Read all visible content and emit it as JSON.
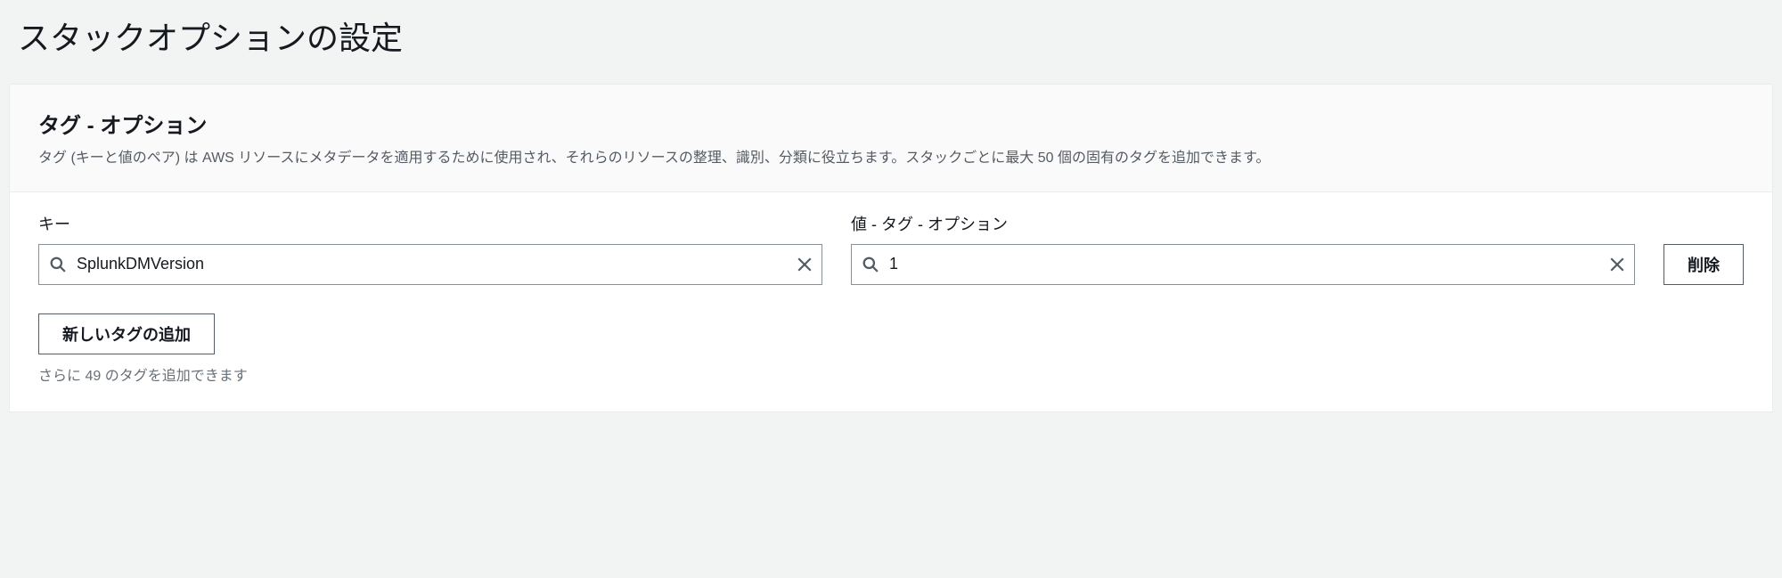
{
  "page": {
    "title": "スタックオプションの設定"
  },
  "tags_section": {
    "title": "タグ - オプション",
    "description": "タグ (キーと値のペア) は AWS リソースにメタデータを適用するために使用され、それらのリソースの整理、識別、分類に役立ちます。スタックごとに最大 50 個の固有のタグを追加できます。",
    "key_label": "キー",
    "value_label": "値 - タグ - オプション",
    "tags": [
      {
        "key": "SplunkDMVersion",
        "value": "1"
      }
    ],
    "remove_label": "削除",
    "add_label": "新しいタグの追加",
    "hint": "さらに 49 のタグを追加できます"
  }
}
